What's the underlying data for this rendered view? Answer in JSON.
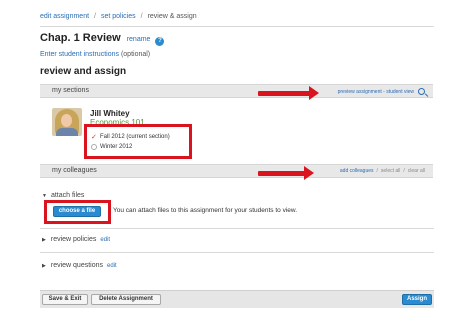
{
  "breadcrumb": {
    "edit_assignment": "edit assignment",
    "sep1": "/",
    "set_policies": "set policies",
    "sep2": "/",
    "current": "review & assign"
  },
  "header": {
    "title": "Chap. 1 Review",
    "rename": "rename",
    "help_icon": "?",
    "instructions_link": "Enter student instructions",
    "instructions_note": "(optional)"
  },
  "review": {
    "title": "review and assign",
    "my_sections_label": "my sections",
    "preview_link": "preview assignment - student view"
  },
  "student": {
    "name": "Jill Whitey",
    "course": "Economics 101",
    "sections": [
      {
        "label": "Fall 2012 (current section)",
        "checked": true,
        "mark": "✓"
      },
      {
        "label": "Winter 2012",
        "checked": false
      }
    ]
  },
  "colleagues": {
    "label": "my colleagues",
    "add": "add colleagues",
    "select_all": "select all",
    "clear_all": "clear all",
    "slash": "/"
  },
  "attach": {
    "label": "attach files",
    "choose_button": "choose a file",
    "text": "You can attach files to this assignment for your students to view."
  },
  "review_policies": {
    "label": "review policies",
    "edit": "edit"
  },
  "review_questions": {
    "label": "review questions",
    "edit": "edit"
  },
  "footer": {
    "save_exit": "Save & Exit",
    "delete": "Delete Assignment",
    "assign": "Assign"
  },
  "icons": {
    "caret_down": "▼",
    "caret_right": "▶",
    "search": "search-icon",
    "arrow": "arrow-right-icon"
  },
  "colors": {
    "accent_blue": "#2a8bd0",
    "link_blue": "#2a6db5",
    "annotation_red": "#d9141e",
    "course_green": "#4a9a3a"
  }
}
